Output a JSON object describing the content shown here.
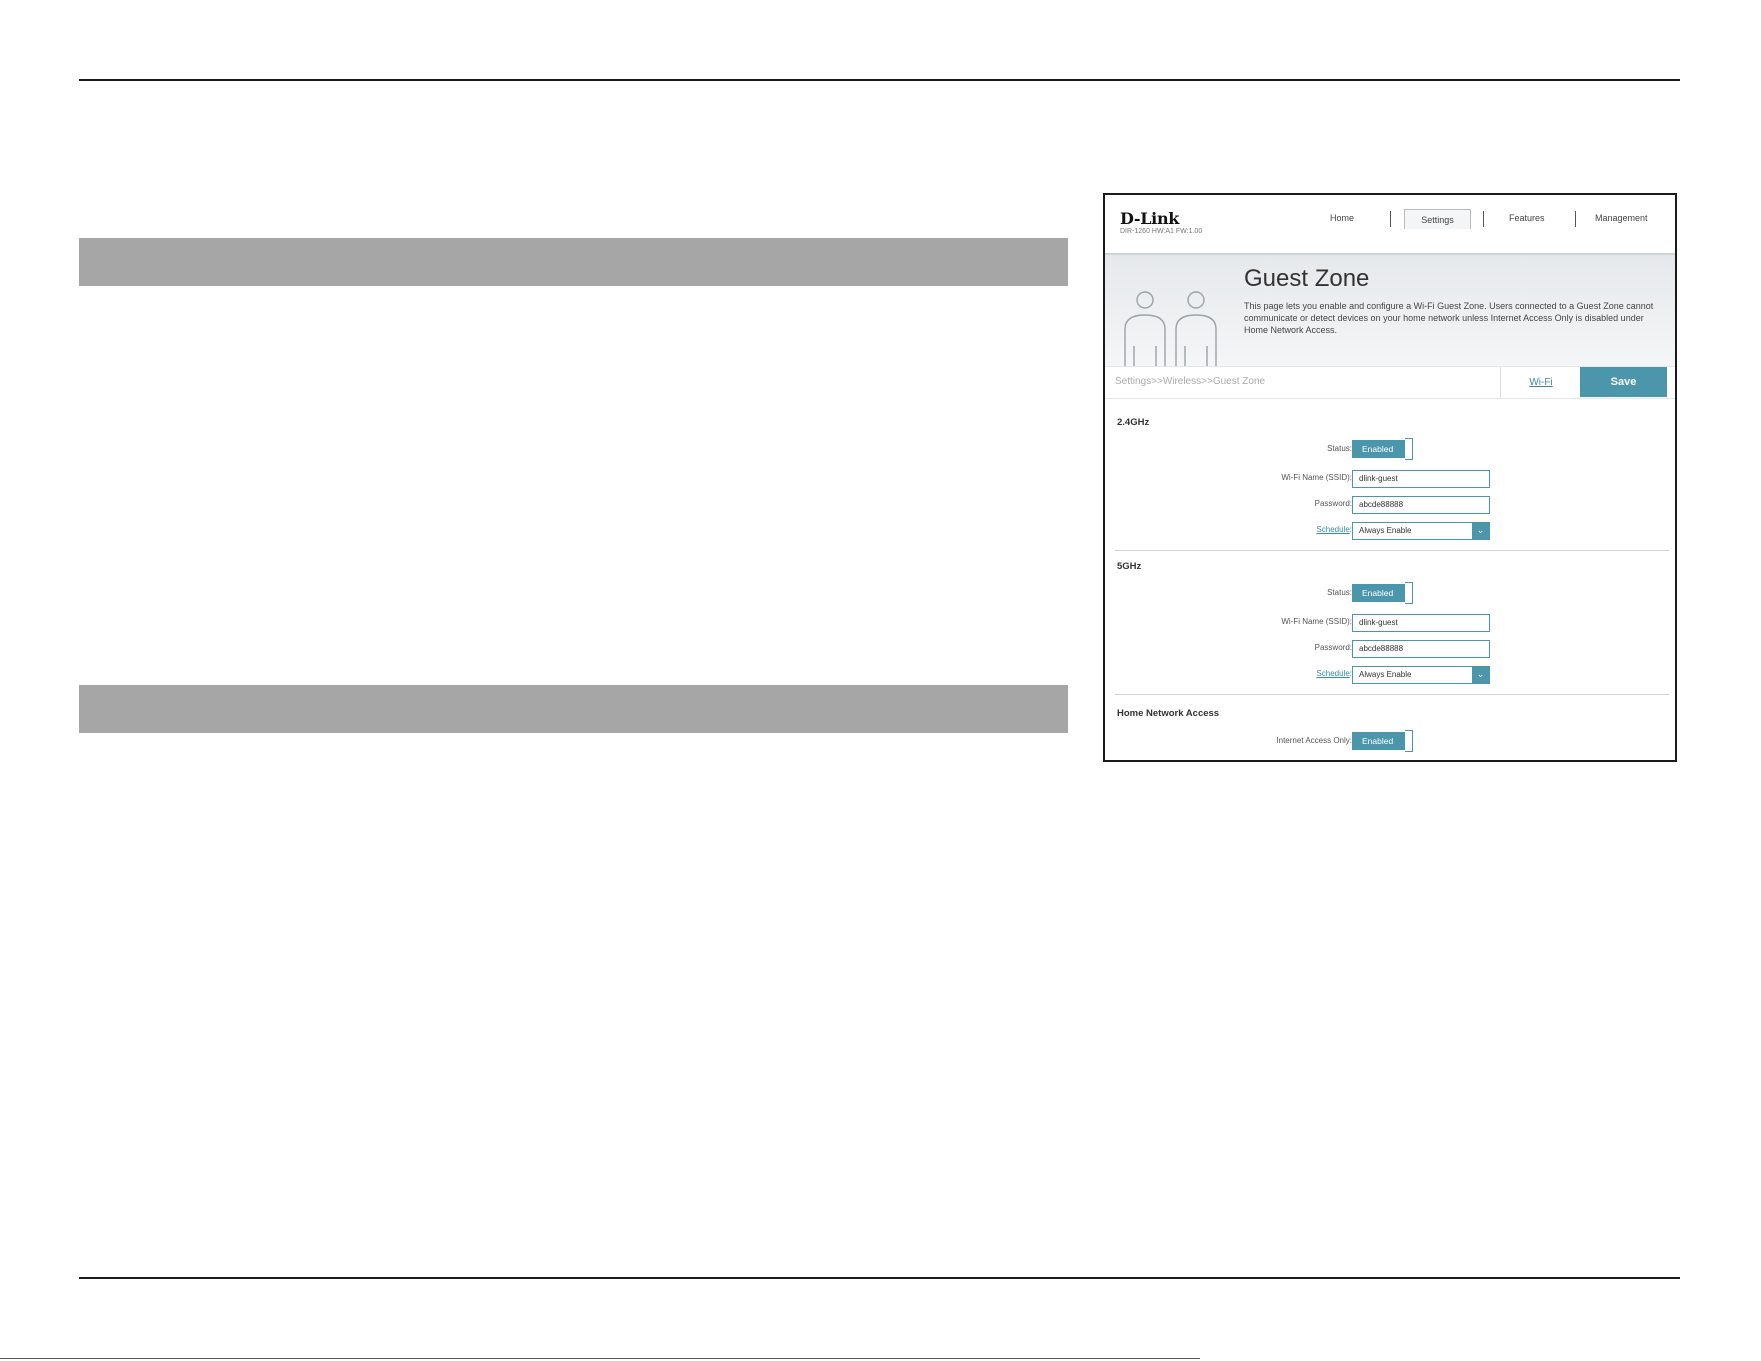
{
  "router": {
    "logo": "D-Link",
    "model_info": "DIR-1260 HW:A1 FW:1.00",
    "nav": {
      "home": "Home",
      "settings": "Settings",
      "features": "Features",
      "management": "Management"
    },
    "page_title": "Guest Zone",
    "page_description": "This page lets you enable and configure a Wi-Fi Guest Zone. Users connected to a Guest Zone cannot communicate or detect devices on your home network unless Internet Access Only is disabled under Home Network Access.",
    "breadcrumb": "Settings>>Wireless>>Guest Zone",
    "wifi_tab": "Wi-Fi",
    "save": "Save",
    "band_24": {
      "title": "2.4GHz",
      "status_label": "Status:",
      "status_value": "Enabled",
      "ssid_label": "Wi-Fi Name (SSID):",
      "ssid_value": "dlink-guest",
      "password_label": "Password:",
      "password_value": "abcde88888",
      "schedule_label": "Schedule",
      "schedule_value": "Always Enable"
    },
    "band_5": {
      "title": "5GHz",
      "status_label": "Status:",
      "status_value": "Enabled",
      "ssid_label": "Wi-Fi Name (SSID):",
      "ssid_value": "dlink-guest",
      "password_label": "Password:",
      "password_value": "abcde88888",
      "schedule_label": "Schedule",
      "schedule_value": "Always Enable"
    },
    "home_access": {
      "title": "Home Network Access",
      "internet_only_label": "Internet Access Only:",
      "internet_only_value": "Enabled"
    }
  },
  "colors": {
    "accent": "#4b96aa",
    "section_bar": "#a6a6a6"
  }
}
